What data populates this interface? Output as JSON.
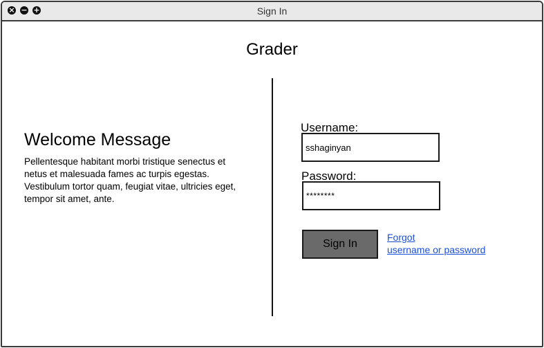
{
  "window": {
    "title": "Sign In",
    "controls": [
      "close-icon",
      "minimize-icon",
      "expand-icon"
    ]
  },
  "app": {
    "title": "Grader"
  },
  "welcome": {
    "heading": "Welcome Message",
    "body": "Pellentesque habitant morbi tristique senectus et netus et malesuada fames ac turpis egestas. Vestibulum tortor quam, feugiat vitae, ultricies eget, tempor sit amet, ante."
  },
  "form": {
    "username_label": "Username:",
    "username_value": "sshaginyan",
    "password_label": "Password:",
    "password_value": "********",
    "signin_label": "Sign In",
    "forgot_line1": "Forgot",
    "forgot_line2": "username or password"
  },
  "colors": {
    "button_fill": "#6a6a6a",
    "link": "#1a4fd6",
    "titlebar": "#e9e9e9"
  }
}
